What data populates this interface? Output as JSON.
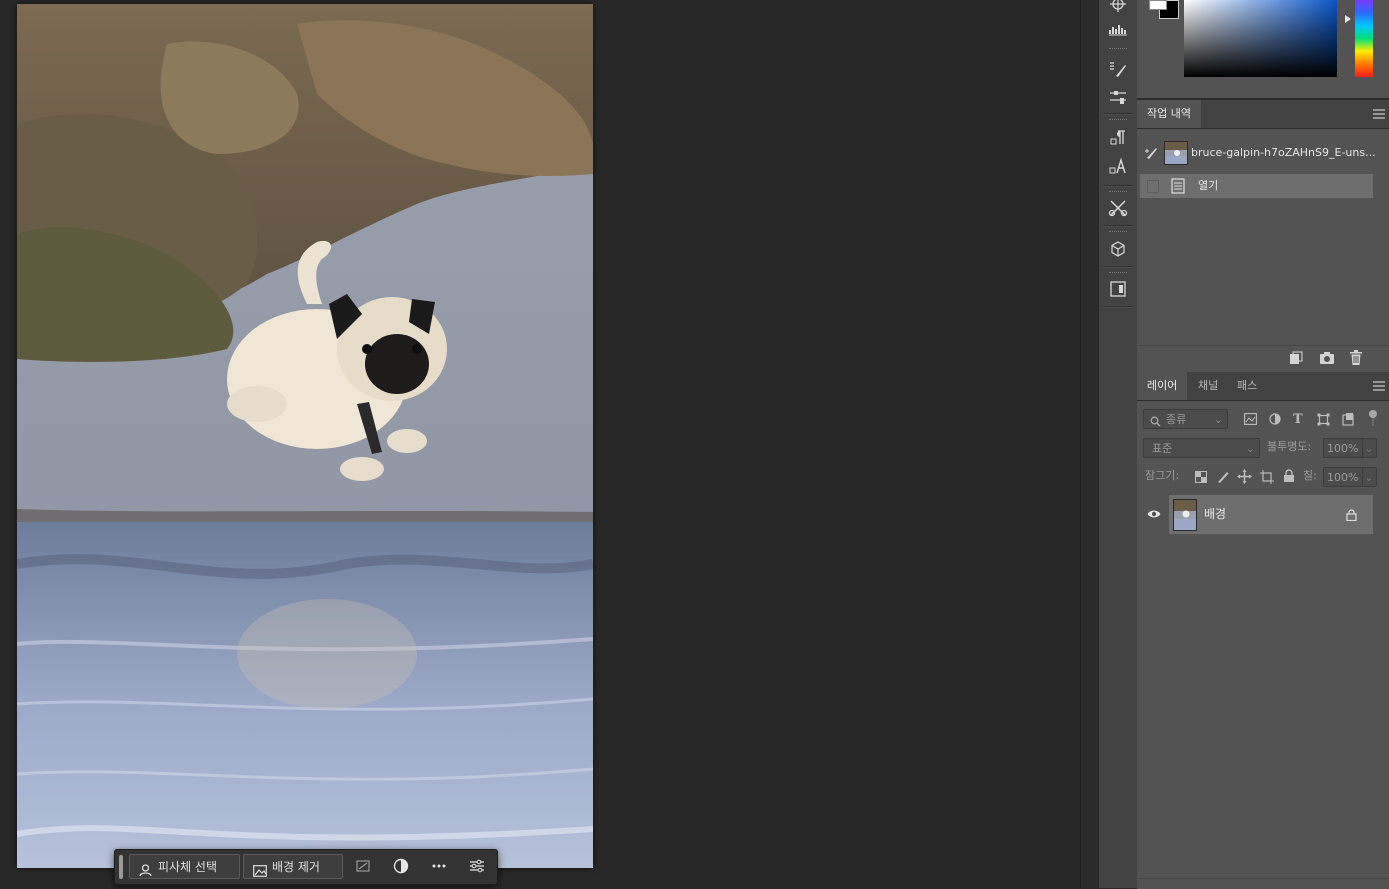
{
  "taskbar": {
    "select_subject_label": "피사체 선택",
    "remove_background_label": "배경 제거"
  },
  "history_panel": {
    "tab_label": "작업 내역",
    "snapshot_name": "bruce-galpin-h7oZAHnS9_E-uns...",
    "items": [
      {
        "label": "열기"
      }
    ]
  },
  "layers_panel": {
    "tabs": [
      {
        "label": "레이어"
      },
      {
        "label": "채널"
      },
      {
        "label": "패스"
      }
    ],
    "filter_placeholder": "종류",
    "blend_mode": "표준",
    "opacity_label": "불투명도:",
    "opacity_value": "100%",
    "lock_label": "잠그기:",
    "fill_label": "칠:",
    "fill_value": "100%",
    "layers": [
      {
        "name": "배경",
        "visible": true,
        "locked": true
      }
    ]
  },
  "colors": {
    "foreground": "#ffffff",
    "background": "#000000",
    "accent_panel": "#535353"
  }
}
